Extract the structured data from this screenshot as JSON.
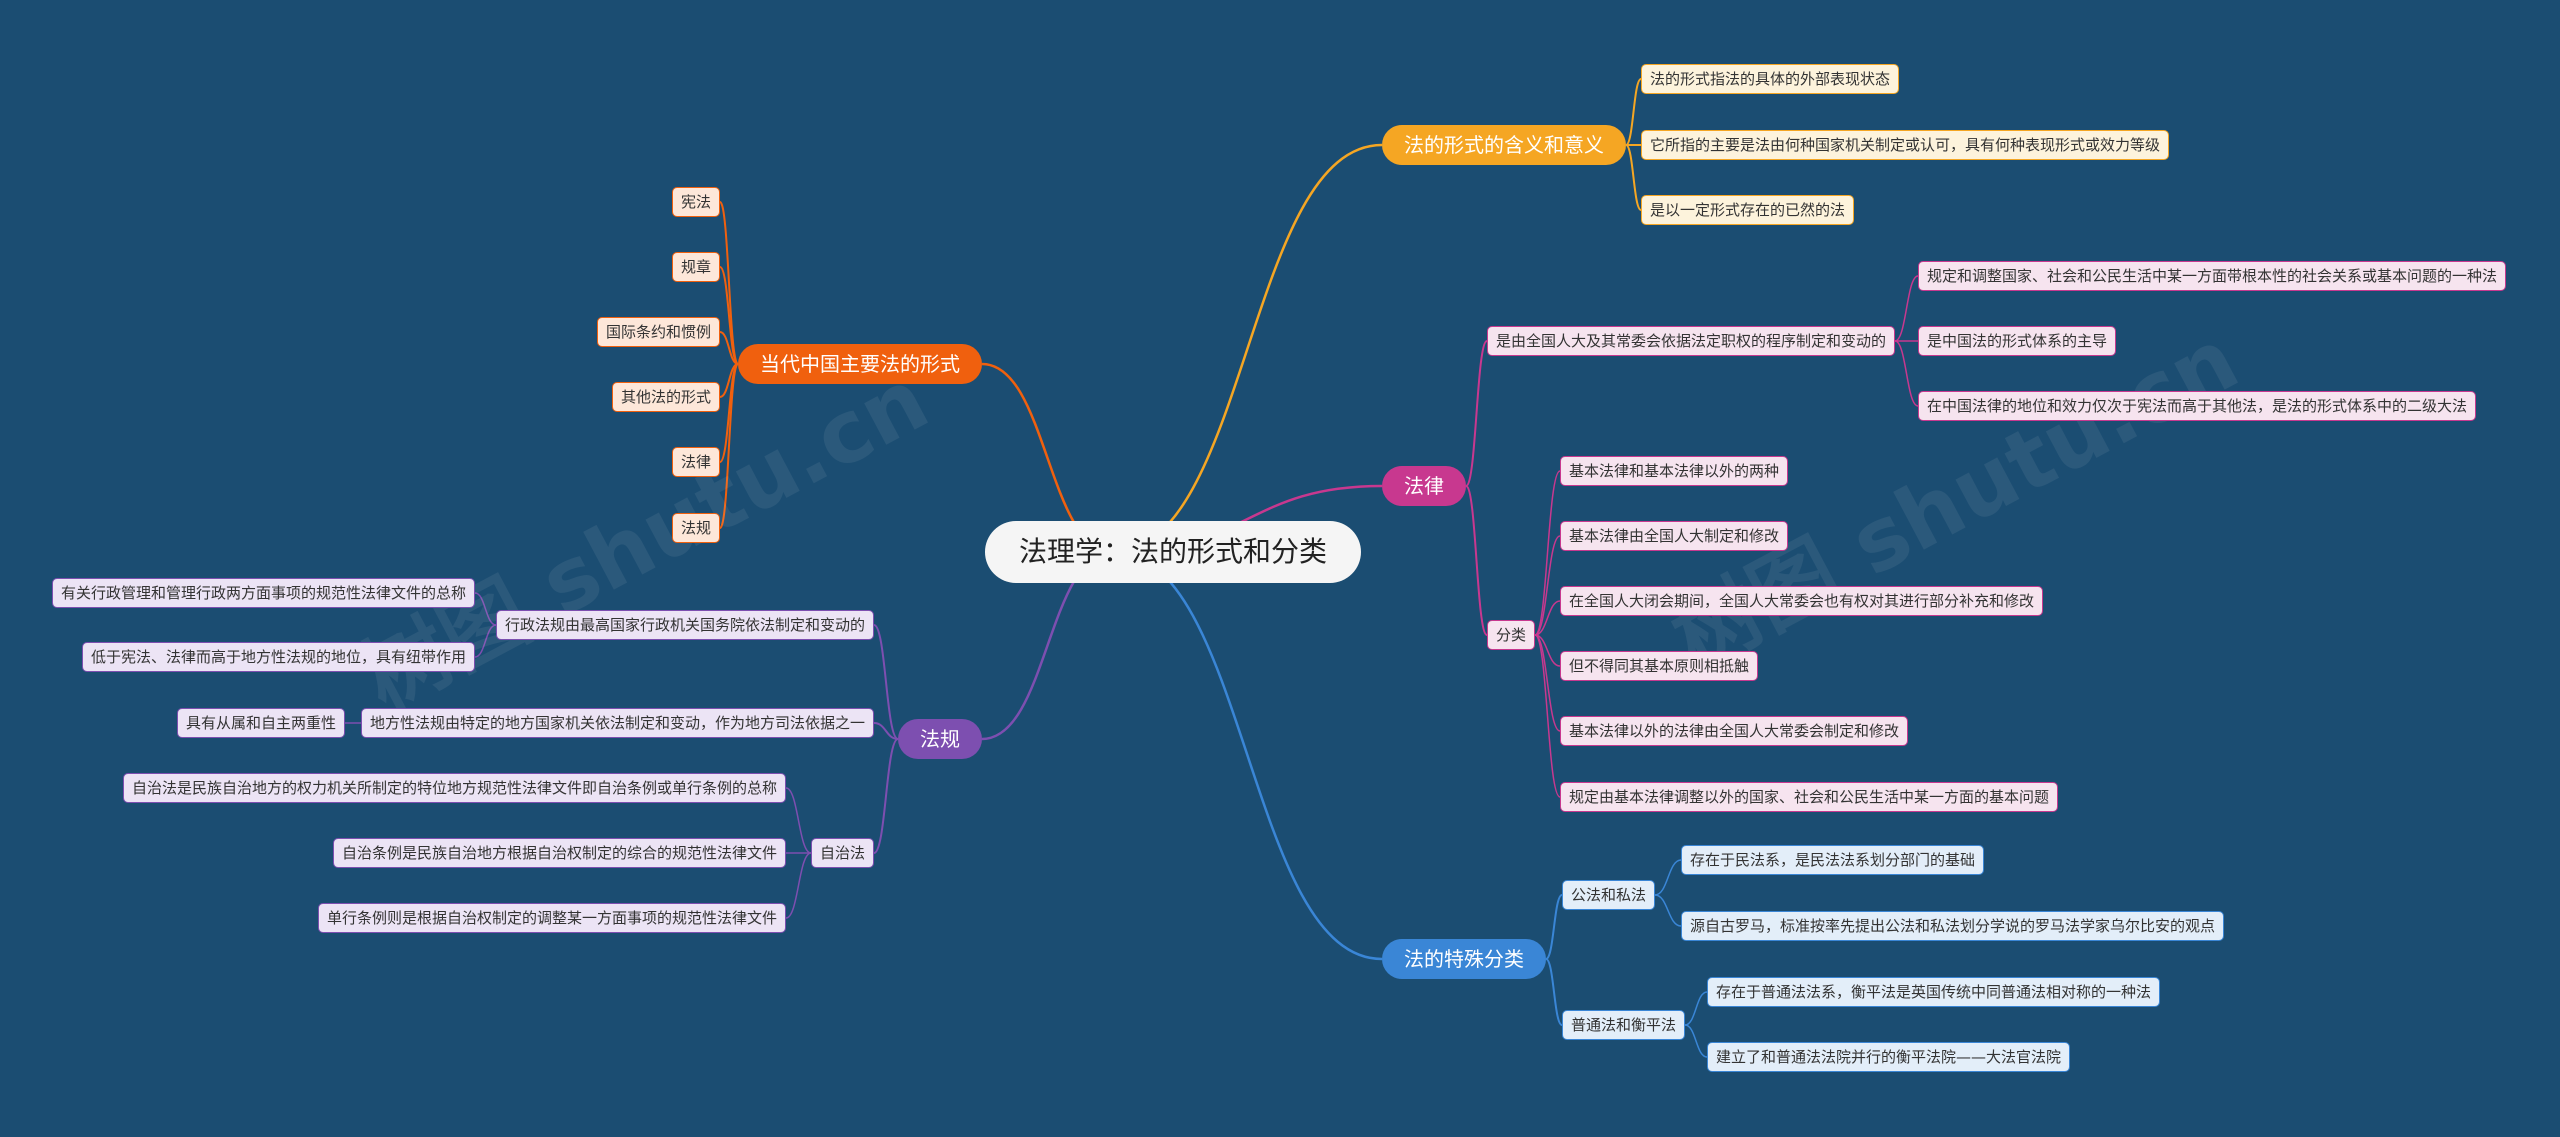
{
  "watermark": "树图 shutu.cn",
  "root": "法理学：法的形式和分类",
  "branches": {
    "meaning": {
      "title": "法的形式的含义和意义",
      "items": [
        "法的形式指法的具体的外部表现状态",
        "它所指的主要是法由何种国家机关制定或认可，具有何种表现形式或效力等级",
        "是以一定形式存在的已然的法"
      ]
    },
    "law": {
      "title": "法律",
      "definition": "是由全国人大及其常委会依据法定职权的程序制定和变动的",
      "definition_items": [
        "规定和调整国家、社会和公民生活中某一方面带根本性的社会关系或基本问题的一种法",
        "是中国法的形式体系的主导",
        "在中国法律的地位和效力仅次于宪法而高于其他法，是法的形式体系中的二级大法"
      ],
      "classification": "分类",
      "classification_items": [
        "基本法律和基本法律以外的两种",
        "基本法律由全国人大制定和修改",
        "在全国人大闭会期间，全国人大常委会也有权对其进行部分补充和修改",
        "但不得同其基本原则相抵触",
        "基本法律以外的法律由全国人大常委会制定和修改",
        "规定由基本法律调整以外的国家、社会和公民生活中某一方面的基本问题"
      ]
    },
    "special": {
      "title": "法的特殊分类",
      "groups": [
        {
          "label": "公法和私法",
          "items": [
            "存在于民法系，是民法法系划分部门的基础",
            "源自古罗马，标准按率先提出公法和私法划分学说的罗马法学家乌尔比安的观点"
          ]
        },
        {
          "label": "普通法和衡平法",
          "items": [
            "存在于普通法法系，衡平法是英国传统中同普通法相对称的一种法",
            "建立了和普通法法院并行的衡平法院——大法官法院"
          ]
        }
      ]
    },
    "forms": {
      "title": "当代中国主要法的形式",
      "items": [
        "宪法",
        "规章",
        "国际条约和惯例",
        "其他法的形式",
        "法律",
        "法规"
      ]
    },
    "regulations": {
      "title": "法规",
      "groups": [
        {
          "label": "行政法规由最高国家行政机关国务院依法制定和变动的",
          "items": [
            "有关行政管理和管理行政两方面事项的规范性法律文件的总称",
            "低于宪法、法律而高于地方性法规的地位，具有纽带作用"
          ]
        },
        {
          "label": "地方性法规由特定的地方国家机关依法制定和变动，作为地方司法依据之一",
          "items": [
            "具有从属和自主两重性"
          ]
        },
        {
          "label": "自治法",
          "items": [
            "自治法是民族自治地方的权力机关所制定的特位地方规范性法律文件即自治条例或单行条例的总称",
            "自治条例是民族自治地方根据自治权制定的综合的规范性法律文件",
            "单行条例则是根据自治权制定的调整某一方面事项的规范性法律文件"
          ]
        }
      ]
    }
  },
  "colors": {
    "background": "#1b4d72",
    "meaning": "#f5a623",
    "meaning_fill": "#fdf3dc",
    "law": "#c8388f",
    "law_fill": "#f6e4ef",
    "special": "#3a86d6",
    "special_fill": "#e3eef9",
    "forms": "#f0600e",
    "forms_fill": "#fde7d9",
    "regulations": "#7d4fb0",
    "regulations_fill": "#ece4f5"
  }
}
